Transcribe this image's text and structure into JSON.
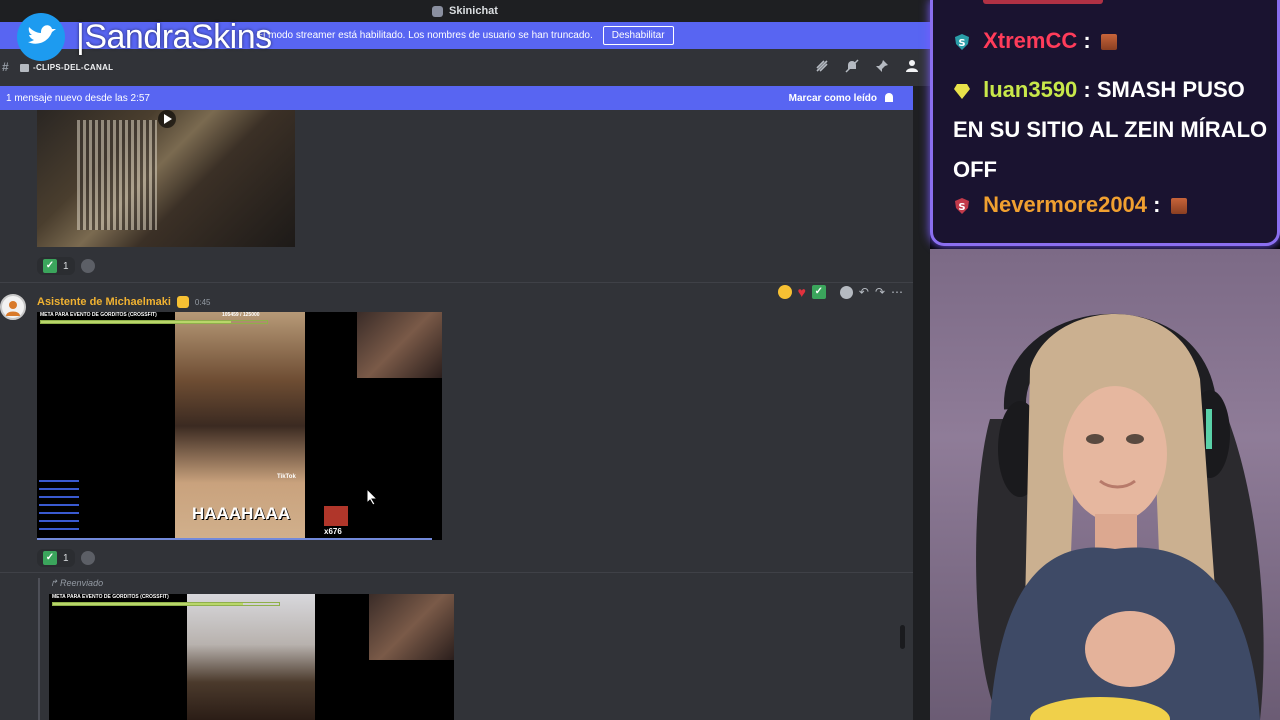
{
  "window": {
    "title": "Skinichat"
  },
  "streamer": {
    "handle": "|SandraSkins"
  },
  "banner": {
    "text": "El modo streamer está habilitado. Los nombres de usuario se han truncado.",
    "button_label": "Deshabilitar"
  },
  "channel": {
    "name": "-CLIPS-DEL-CANAL"
  },
  "new_messages": {
    "text": "1 mensaje nuevo desde las 2:57",
    "mark_read_label": "Marcar como leído"
  },
  "messages": [
    {
      "reaction_count": "1"
    },
    {
      "author": "Asistente de Michaelmaki",
      "time": "0:45",
      "reaction_count": "1",
      "video": {
        "meta": "META PARA EVENTO DE GORDITOS (CROSSFIT)",
        "meta_progress": "105459 / 125000",
        "caption": "HAAAHAAA",
        "tiktok": "TikTok",
        "badge": "x676"
      }
    },
    {
      "forward_label": "Reenviado",
      "video": {
        "meta": "META PARA EVENTO DE GORDITOS (CROSSFIT)"
      }
    }
  ],
  "stream_chat": [
    {
      "name": "XtremCC",
      "color": "#ff3c5a",
      "text": ":"
    },
    {
      "name": "luan3590",
      "color": "#c8e84a",
      "text": ": SMASH PUSO EN SU SITIO AL ZEIN MÍRALO OFF"
    },
    {
      "name": "Nevermore2004",
      "color": "#f0a030",
      "text": ":"
    }
  ],
  "colors": {
    "accent": "#5865f2",
    "author": "#f0b232",
    "overlay_border": "#8b6ff0"
  }
}
